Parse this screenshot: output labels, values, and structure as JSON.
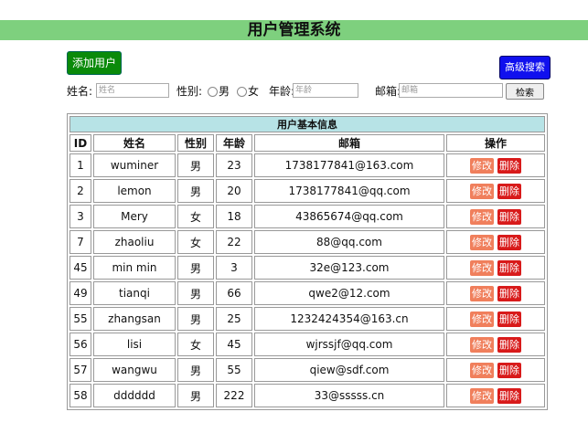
{
  "page_title": "用户管理系统",
  "add_button": "添加用户",
  "advanced_search_button": "高级搜索",
  "search": {
    "name_label": "姓名:",
    "name_placeholder": "姓名",
    "gender_label": "性别:",
    "male_label": "男",
    "female_label": "女",
    "age_label": "年龄:",
    "age_placeholder": "年龄",
    "email_label": "邮箱:",
    "email_placeholder": "邮箱",
    "search_button": "检索"
  },
  "table": {
    "caption": "用户基本信息",
    "headers": [
      "ID",
      "姓名",
      "性别",
      "年龄",
      "邮箱",
      "操作"
    ],
    "edit_label": "修改",
    "delete_label": "删除",
    "rows": [
      {
        "id": "1",
        "name": "wuminer",
        "gender": "男",
        "age": "23",
        "email": "1738177841@163.com"
      },
      {
        "id": "2",
        "name": "lemon",
        "gender": "男",
        "age": "20",
        "email": "1738177841@qq.com"
      },
      {
        "id": "3",
        "name": "Mery",
        "gender": "女",
        "age": "18",
        "email": "43865674@qq.com"
      },
      {
        "id": "7",
        "name": "zhaoliu",
        "gender": "女",
        "age": "22",
        "email": "88@qq.com"
      },
      {
        "id": "45",
        "name": "min min",
        "gender": "男",
        "age": "3",
        "email": "32e@123.com"
      },
      {
        "id": "49",
        "name": "tianqi",
        "gender": "男",
        "age": "66",
        "email": "qwe2@12.com"
      },
      {
        "id": "55",
        "name": "zhangsan",
        "gender": "男",
        "age": "25",
        "email": "1232424354@163.cn"
      },
      {
        "id": "56",
        "name": "lisi",
        "gender": "女",
        "age": "45",
        "email": "wjrssjf@qq.com"
      },
      {
        "id": "57",
        "name": "wangwu",
        "gender": "男",
        "age": "55",
        "email": "qiew@sdf.com"
      },
      {
        "id": "58",
        "name": "dddddd",
        "gender": "男",
        "age": "222",
        "email": "33@sssss.cn"
      }
    ]
  }
}
